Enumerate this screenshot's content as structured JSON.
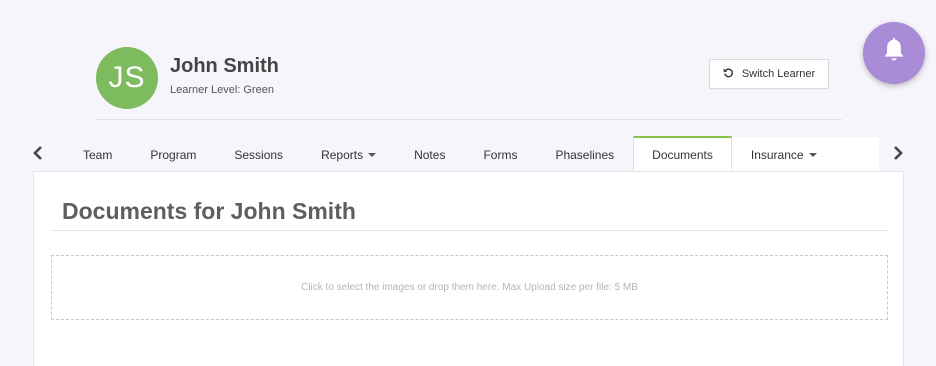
{
  "learner": {
    "initials": "JS",
    "name": "John Smith",
    "level": "Learner Level: Green",
    "avatar_color": "#7dbb5e"
  },
  "header": {
    "switch_label": "Switch Learner",
    "switch_icon": "refresh-icon",
    "notification_icon": "bell-icon",
    "notification_color": "#a98bd6"
  },
  "tabs": [
    {
      "label": "Team",
      "dropdown": false,
      "active": false
    },
    {
      "label": "Program",
      "dropdown": false,
      "active": false
    },
    {
      "label": "Sessions",
      "dropdown": false,
      "active": false
    },
    {
      "label": "Reports",
      "dropdown": true,
      "active": false
    },
    {
      "label": "Notes",
      "dropdown": false,
      "active": false
    },
    {
      "label": "Forms",
      "dropdown": false,
      "active": false
    },
    {
      "label": "Phaselines",
      "dropdown": false,
      "active": false
    },
    {
      "label": "Documents",
      "dropdown": false,
      "active": true
    },
    {
      "label": "Insurance",
      "dropdown": true,
      "active": false
    }
  ],
  "tab_accent_color": "#8bc34a",
  "nav": {
    "left_icon": "chevron-left-icon",
    "right_icon": "chevron-right-icon"
  },
  "documents": {
    "title": "Documents for John Smith",
    "dropzone_text": "Click to select the images or drop them here. Max Upload size per file: 5 MB"
  }
}
